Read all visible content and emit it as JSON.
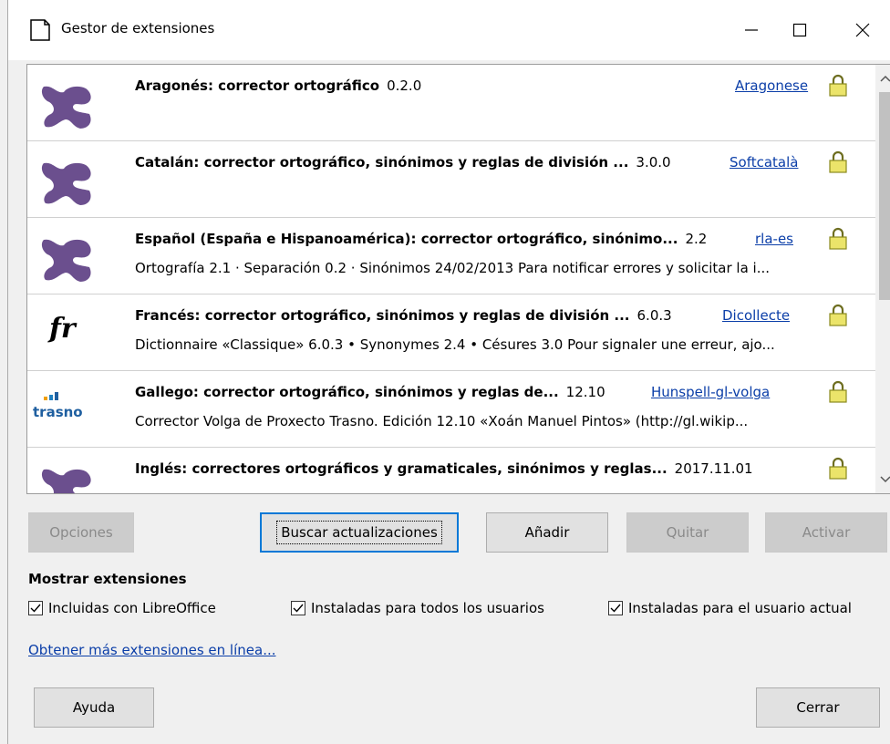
{
  "window": {
    "title": "Gestor de extensiones"
  },
  "extensions": [
    {
      "name": "Aragonés: corrector ortográfico",
      "version": "0.2.0",
      "publisher": "Aragonese",
      "description": "",
      "icon": "puzzle-icon"
    },
    {
      "name": "Catalán: corrector ortográfico, sinónimos y reglas de división ...",
      "version": "3.0.0",
      "publisher": "Softcatalà",
      "description": "",
      "icon": "puzzle-icon"
    },
    {
      "name": "Español (España e Hispanoamérica): corrector ortográfico, sinónimo...",
      "version": "2.2",
      "publisher": "rla-es",
      "description": "Ortografía 2.1 · Separación 0.2 · Sinónimos 24/02/2013  Para notificar errores y solicitar la i...",
      "icon": "puzzle-icon"
    },
    {
      "name": "Francés: corrector ortográfico, sinónimos y reglas de división ...",
      "version": "6.0.3",
      "publisher": "Dicollecte",
      "description": "Dictionnaire «Classique» 6.0.3 • Synonymes 2.4 • Césures 3.0   Pour signaler une erreur, ajo...",
      "icon": "fr-icon",
      "icon_text": "fr"
    },
    {
      "name": "Gallego: corrector ortográfico, sinónimos y reglas de...",
      "version": "12.10",
      "publisher": "Hunspell-gl-volga",
      "description": "Corrector Volga de Proxecto Trasno.  Edición 12.10 «Xoán Manuel Pintos» (http://gl.wikip...",
      "icon": "trasno-logo",
      "icon_text": "trasno"
    },
    {
      "name": "Inglés: correctores ortográficos y gramaticales, sinónimos y reglas...",
      "version": "2017.11.01",
      "publisher": "",
      "description": "",
      "icon": "puzzle-icon"
    }
  ],
  "buttons": {
    "options": "Opciones",
    "check_updates": "Buscar actualizaciones",
    "add": "Añadir",
    "remove": "Quitar",
    "enable": "Activar",
    "help": "Ayuda",
    "close": "Cerrar"
  },
  "filters": {
    "heading": "Mostrar extensiones",
    "bundled": {
      "label": "Incluidas con LibreOffice",
      "checked": true
    },
    "shared": {
      "label": "Instaladas para todos los usuarios",
      "checked": true
    },
    "user": {
      "label": "Instaladas para el usuario actual",
      "checked": true
    }
  },
  "get_more_link": "Obtener más extensiones en línea...",
  "colors": {
    "link": "#0b3ea8",
    "puzzle": "#6b4f8e",
    "focus": "#0078d7"
  }
}
